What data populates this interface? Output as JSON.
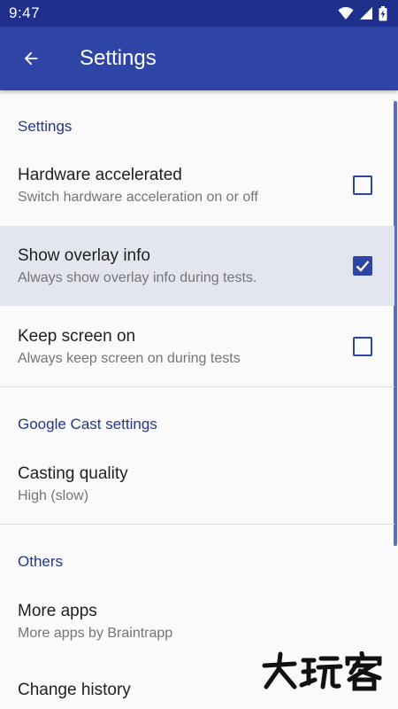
{
  "status_bar": {
    "time": "9:47",
    "icons": [
      "wifi-icon",
      "signal-icon",
      "battery-charging-icon"
    ]
  },
  "app_bar": {
    "back_icon": "arrow-left-icon",
    "title": "Settings"
  },
  "sections": {
    "settings": {
      "header": "Settings"
    },
    "cast": {
      "header": "Google Cast settings"
    },
    "others": {
      "header": "Others"
    }
  },
  "prefs": {
    "hardware": {
      "title": "Hardware accelerated",
      "summary": "Switch hardware acceleration on or off",
      "checked": false
    },
    "overlay": {
      "title": "Show overlay info",
      "summary": "Always show overlay info during tests.",
      "checked": true
    },
    "screen": {
      "title": "Keep screen on",
      "summary": "Always keep screen on during tests",
      "checked": false
    },
    "casting": {
      "title": "Casting quality",
      "summary": "High (slow)"
    },
    "more_apps": {
      "title": "More apps",
      "summary": "More apps by Braintrapp"
    },
    "history": {
      "title": "Change history"
    }
  },
  "watermark": {
    "text": "大玩客"
  },
  "colors": {
    "status_bar": "#1f2f8c",
    "app_bar": "#2f45a6",
    "accent": "#2f45a6",
    "section_header": "#24368f"
  }
}
